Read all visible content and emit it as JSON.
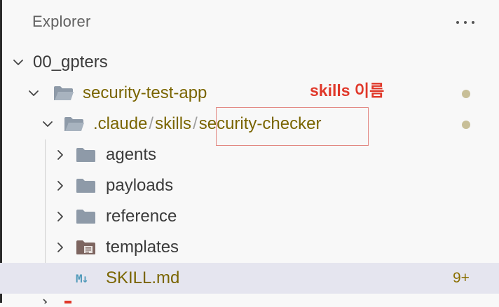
{
  "header": {
    "title": "Explorer",
    "more_icon": "ellipsis-icon"
  },
  "annotation": {
    "text": "skills 이름",
    "color": "#e0382a"
  },
  "tree": {
    "root": {
      "label": "00_gpters"
    },
    "project": {
      "label": "security-test-app"
    },
    "path": {
      "segments": [
        ".claude",
        "skills",
        "security-checker"
      ],
      "separator": "/"
    },
    "children": [
      {
        "label": "agents",
        "icon": "folder-icon"
      },
      {
        "label": "payloads",
        "icon": "folder-icon"
      },
      {
        "label": "reference",
        "icon": "folder-icon"
      },
      {
        "label": "templates",
        "icon": "templates-folder-icon"
      }
    ],
    "file": {
      "label": "SKILL.md",
      "icon_glyph": "M↓",
      "badge": "9+"
    }
  },
  "colors": {
    "modified_text": "#7a6500",
    "folder": "#8e9aa8",
    "highlight": "#e28680",
    "selected_row": "#e5e5ef"
  }
}
